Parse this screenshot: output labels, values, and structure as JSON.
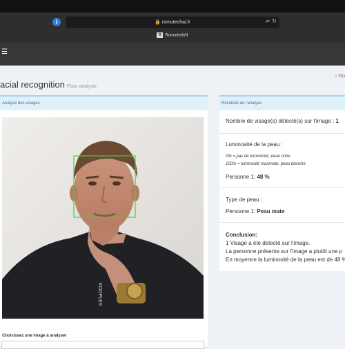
{
  "browser": {
    "url": "romutechai.fr",
    "tab_title": "RomutechAI",
    "tab_logo": "R"
  },
  "page": {
    "title": "acial recognition",
    "subtitle": "Face analysis",
    "breadcrumb": "Ou"
  },
  "left_panel": {
    "header": "Analyse des visages",
    "photo_watermark": "KOOPLES",
    "choose_label": "Choisissez une image à analyser"
  },
  "right_panel": {
    "header": "Résultats de l'analyse",
    "faces_label": "Nombre de visage(s) détecté(s) sur l'image :",
    "faces_value": "1",
    "lum_title": "Luminosité de la peau :",
    "lum_note1": "0% = pas de luminosité, peau noire",
    "lum_note2": "100% = luminosité maximale, peau blanche",
    "lum_person": "Personne 1:",
    "lum_value": "48 %",
    "type_title": "Type de peau :",
    "type_person": "Personne 1:",
    "type_value": "Peau mate",
    "conclusion_title": "Conclusion:",
    "conclusion_1": "1 Visage a été detecté sur l'image.",
    "conclusion_2": "La personne présente sur l'image a plutôt une p",
    "conclusion_3": "En moyenne la luminosité de la peau est de 48 %"
  },
  "colors": {
    "accent_border": "#9fd4ef",
    "panel_header": "#e0f0f9",
    "face_box": "#3cd43c",
    "appbar": "#373737"
  }
}
